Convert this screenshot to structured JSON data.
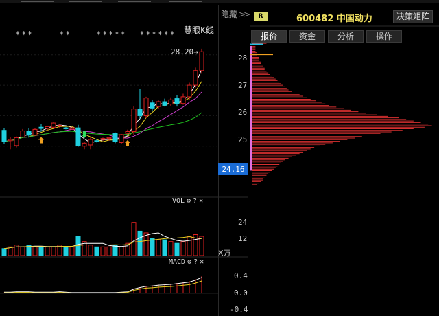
{
  "toolbar": {
    "hide_label": "隐藏",
    "hide_chevron": ">>"
  },
  "main": {
    "stars": [
      "***",
      "**",
      "*****",
      "******"
    ],
    "huiyan_label": "慧眼K线",
    "max_price_label": "28.20→",
    "price_axis": [
      "28",
      "27",
      "26",
      "25"
    ],
    "current_price": "24.16"
  },
  "vol": {
    "title": "VOL",
    "axis": [
      "24",
      "12"
    ],
    "unit": "X万"
  },
  "macd": {
    "title": "MACD",
    "axis": [
      "0.4",
      "0.0",
      "-0.4"
    ]
  },
  "quote": {
    "badge": "R",
    "code_name": "600482 中国动力",
    "decision_button": "决策矩阵",
    "tabs": [
      {
        "label": "报价",
        "active": true
      },
      {
        "label": "资金",
        "active": false
      },
      {
        "label": "分析",
        "active": false
      },
      {
        "label": "操作",
        "active": false
      }
    ]
  },
  "icons": {
    "gear": "gear-icon",
    "help": "help-icon",
    "close": "close-icon"
  },
  "colors": {
    "up": "#e02020",
    "down": "#20d0e0",
    "ma_white": "#ffffff",
    "ma_yellow": "#e8d020",
    "ma_purple": "#d040d0",
    "ma_green": "#20c020",
    "highlight": "#1a6cd6"
  },
  "chart_data": {
    "type": "candlestick",
    "price_ylim": [
      24.16,
      28.4
    ],
    "candles": [
      {
        "o": 25.52,
        "h": 25.58,
        "l": 25.08,
        "c": 25.15
      },
      {
        "o": 25.18,
        "h": 25.3,
        "l": 24.9,
        "c": 25.22
      },
      {
        "o": 25.02,
        "h": 25.32,
        "l": 24.96,
        "c": 25.28
      },
      {
        "o": 25.3,
        "h": 25.56,
        "l": 25.28,
        "c": 25.5
      },
      {
        "o": 25.5,
        "h": 25.58,
        "l": 25.28,
        "c": 25.36
      },
      {
        "o": 25.36,
        "h": 25.58,
        "l": 25.33,
        "c": 25.55
      },
      {
        "o": 25.62,
        "h": 25.72,
        "l": 25.48,
        "c": 25.58
      },
      {
        "o": 25.58,
        "h": 25.66,
        "l": 25.52,
        "c": 25.64
      },
      {
        "o": 25.62,
        "h": 25.78,
        "l": 25.58,
        "c": 25.76
      },
      {
        "o": 25.66,
        "h": 25.73,
        "l": 25.58,
        "c": 25.68
      },
      {
        "o": 25.6,
        "h": 25.63,
        "l": 25.55,
        "c": 25.57
      },
      {
        "o": 25.56,
        "h": 25.62,
        "l": 25.54,
        "c": 25.6
      },
      {
        "o": 25.6,
        "h": 25.7,
        "l": 24.98,
        "c": 25.02
      },
      {
        "o": 25.0,
        "h": 25.15,
        "l": 24.9,
        "c": 25.1
      },
      {
        "o": 25.04,
        "h": 25.3,
        "l": 24.9,
        "c": 25.22
      },
      {
        "o": 25.18,
        "h": 25.24,
        "l": 25.12,
        "c": 25.15
      },
      {
        "o": 25.22,
        "h": 25.28,
        "l": 25.18,
        "c": 25.25
      },
      {
        "o": 25.25,
        "h": 25.3,
        "l": 25.18,
        "c": 25.28
      },
      {
        "o": 25.42,
        "h": 25.45,
        "l": 25.1,
        "c": 25.15
      },
      {
        "o": 25.12,
        "h": 25.4,
        "l": 25.08,
        "c": 25.38
      },
      {
        "o": 25.42,
        "h": 25.54,
        "l": 25.38,
        "c": 25.48
      },
      {
        "o": 25.48,
        "h": 26.3,
        "l": 25.36,
        "c": 26.22
      },
      {
        "o": 26.22,
        "h": 26.88,
        "l": 25.9,
        "c": 26.0
      },
      {
        "o": 26.0,
        "h": 26.62,
        "l": 25.92,
        "c": 26.58
      },
      {
        "o": 26.42,
        "h": 26.52,
        "l": 26.14,
        "c": 26.25
      },
      {
        "o": 26.3,
        "h": 26.5,
        "l": 26.22,
        "c": 26.46
      },
      {
        "o": 26.46,
        "h": 26.56,
        "l": 26.3,
        "c": 26.34
      },
      {
        "o": 26.38,
        "h": 26.6,
        "l": 26.32,
        "c": 26.52
      },
      {
        "o": 26.56,
        "h": 26.68,
        "l": 26.3,
        "c": 26.4
      },
      {
        "o": 26.4,
        "h": 26.72,
        "l": 26.36,
        "c": 26.62
      },
      {
        "o": 26.62,
        "h": 27.08,
        "l": 26.52,
        "c": 27.0
      },
      {
        "o": 27.0,
        "h": 27.58,
        "l": 26.92,
        "c": 27.48
      },
      {
        "o": 27.48,
        "h": 28.2,
        "l": 27.4,
        "c": 28.1
      }
    ],
    "volume": [
      4,
      5,
      6,
      5,
      6,
      5,
      5,
      5,
      5,
      6,
      5,
      5,
      11,
      8,
      6,
      5,
      5,
      5,
      6,
      5,
      7,
      19,
      14,
      13,
      10,
      9,
      9,
      8,
      7,
      8,
      11,
      12,
      11
    ],
    "vol_ylim": [
      0,
      24
    ],
    "macd": [
      0.02,
      0.02,
      0.03,
      0.03,
      0.03,
      0.02,
      0.02,
      0.02,
      0.02,
      0.03,
      0.02,
      0.01,
      0.01,
      0.01,
      0.01,
      0.01,
      0.01,
      0.01,
      0.01,
      0.02,
      0.03,
      0.1,
      0.14,
      0.17,
      0.18,
      0.2,
      0.21,
      0.22,
      0.24,
      0.26,
      0.28,
      0.33,
      0.4
    ],
    "macd_ylim": [
      -0.4,
      0.4
    ],
    "chip_distribution": {
      "price_range": [
        24.16,
        28.4
      ],
      "bar_length": [
        0.03,
        0.04,
        0.05,
        0.06,
        0.06,
        0.07,
        0.08,
        0.09,
        0.1,
        0.11,
        0.12,
        0.13,
        0.14,
        0.15,
        0.16,
        0.17,
        0.18,
        0.2,
        0.22,
        0.24,
        0.26,
        0.28,
        0.3,
        0.32,
        0.34,
        0.37,
        0.4,
        0.44,
        0.48,
        0.52,
        0.56,
        0.6,
        0.65,
        0.7,
        0.76,
        0.82,
        0.88,
        0.94,
        0.98,
        0.96,
        0.92,
        0.88,
        0.84,
        0.8,
        0.74,
        0.68,
        0.62,
        0.58,
        0.54,
        0.5,
        0.46,
        0.42,
        0.4,
        0.38,
        0.35,
        0.32,
        0.3,
        0.28,
        0.26,
        0.24,
        0.22,
        0.2,
        0.19,
        0.18,
        0.17,
        0.16,
        0.15,
        0.14,
        0.13,
        0.12,
        0.11,
        0.1,
        0.09,
        0.08,
        0.07,
        0.07,
        0.06,
        0.06,
        0.05,
        0.05,
        0.04,
        0.04,
        0.04,
        0.03,
        0.03,
        0.03,
        0.02,
        0.02,
        0.02,
        0.02,
        0.02,
        0.08
      ]
    }
  }
}
